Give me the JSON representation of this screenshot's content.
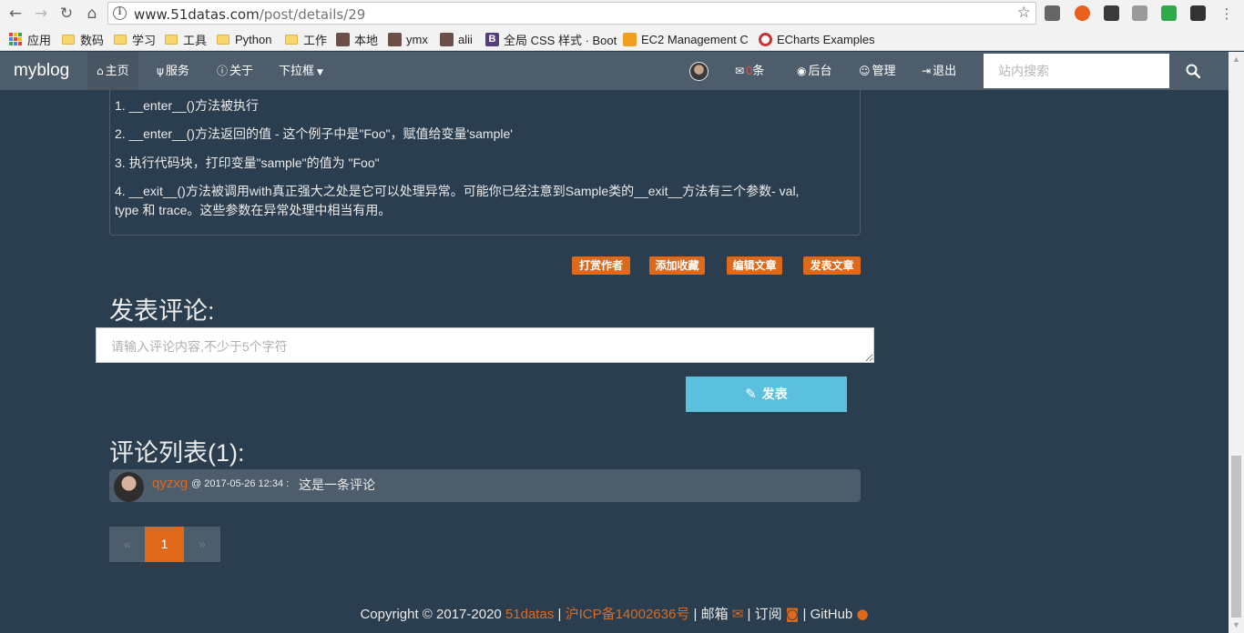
{
  "browser": {
    "url_host": "www.51datas.com",
    "url_path": "/post/details/29",
    "bookmarks": [
      "应用",
      "数码",
      "学习",
      "工具",
      "Python",
      "工作",
      "本地",
      "ymx",
      "alii",
      "全局 CSS 样式 · Boot",
      "EC2 Management C",
      "ECharts Examples"
    ]
  },
  "navbar": {
    "brand": "myblog",
    "items": [
      "主页",
      "服务",
      "关于",
      "下拉框"
    ],
    "mail_count": "0",
    "mail_suffix": "条",
    "right_items": [
      "后台",
      "管理",
      "退出"
    ],
    "search_placeholder": "站内搜索"
  },
  "article": {
    "paragraphs": [
      "1. __enter__()方法被执行",
      "2. __enter__()方法返回的值 - 这个例子中是\"Foo\"，赋值给变量'sample'",
      "3. 执行代码块，打印变量\"sample\"的值为 \"Foo\"",
      "4. __exit__()方法被调用with真正强大之处是它可以处理异常。可能你已经注意到Sample类的__exit__方法有三个参数- val,",
      "type 和 trace。这些参数在异常处理中相当有用。"
    ],
    "actions": [
      "打赏作者",
      "添加收藏",
      "编辑文章",
      "发表文章"
    ]
  },
  "comment_form": {
    "heading": "发表评论:",
    "placeholder": "请输入评论内容,不少于5个字符",
    "submit_label": "发表"
  },
  "comments": {
    "heading": "评论列表(1):",
    "items": [
      {
        "user": "qyzxg",
        "meta": "@ 2017-05-26 12:34 :",
        "text": "这是一条评论"
      }
    ]
  },
  "pagination": {
    "prev": "«",
    "current": "1",
    "next": "»"
  },
  "footer": {
    "copyright": "Copyright © 2017-2020",
    "site": "51datas",
    "icp": "沪ICP备14002636号",
    "mail": "邮箱",
    "subscribe": "订阅",
    "github": "GitHub",
    "sep": "|"
  },
  "colors": {
    "accent": "#df691a",
    "background": "#2b3e50",
    "panel": "#4e5d6c",
    "info": "#5bc0de"
  }
}
